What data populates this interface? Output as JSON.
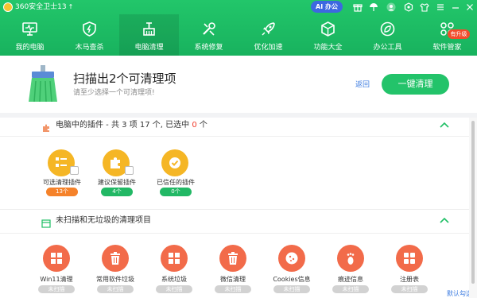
{
  "app": {
    "title": "360安全卫士13",
    "ai_button": "AI 办公"
  },
  "nav": {
    "items": [
      {
        "label": "我的电脑",
        "icon": "monitor-icon",
        "active": false
      },
      {
        "label": "木马查杀",
        "icon": "shield-icon",
        "active": false
      },
      {
        "label": "电脑清理",
        "icon": "broom-icon",
        "active": true
      },
      {
        "label": "系统修复",
        "icon": "wrench-icon",
        "active": false
      },
      {
        "label": "优化加速",
        "icon": "rocket-icon",
        "active": false
      },
      {
        "label": "功能大全",
        "icon": "cube-icon",
        "active": false
      },
      {
        "label": "办公工具",
        "icon": "leaf-icon",
        "active": false
      },
      {
        "label": "软件管家",
        "icon": "apps-icon",
        "active": false
      }
    ],
    "upgrade_badge": "有升级"
  },
  "summary": {
    "title": "扫描出2个可清理项",
    "subtitle": "请至少选择一个可清理项!",
    "back": "返回",
    "clean_button": "一键清理"
  },
  "plugins_section": {
    "title_prefix": "电脑中的插件 - 共 3 项 17 个, 已选中 ",
    "selected_count": "0",
    "title_suffix": " 个",
    "items": [
      {
        "label": "可选清理插件",
        "count": "13个",
        "pill_color": "orange"
      },
      {
        "label": "建议保留插件",
        "count": "4个",
        "pill_color": "green"
      },
      {
        "label": "已信任的插件",
        "count": "0个",
        "pill_color": "green"
      }
    ]
  },
  "unscanned_section": {
    "title": "未扫描和无垃圾的清理项目",
    "items": [
      {
        "label": "Win11清理",
        "status": "未扫描",
        "icon": "windows-icon"
      },
      {
        "label": "常用软件垃圾",
        "status": "未扫描",
        "icon": "trash-icon"
      },
      {
        "label": "系统垃圾",
        "status": "未扫描",
        "icon": "windows-icon"
      },
      {
        "label": "微信清理",
        "status": "未扫描",
        "icon": "trash-icon"
      },
      {
        "label": "Cookies信息",
        "status": "未扫描",
        "icon": "cookie-icon"
      },
      {
        "label": "痕迹信息",
        "status": "未扫描",
        "icon": "footprint-icon"
      },
      {
        "label": "注册表",
        "status": "未扫描",
        "icon": "registry-icon"
      }
    ]
  },
  "footer": {
    "default_select": "默认勾选"
  },
  "colors": {
    "brand_green": "#1fbf65",
    "accent_blue": "#3a7ae0",
    "orange": "#f5822a",
    "tool_red": "#f26b4a"
  }
}
